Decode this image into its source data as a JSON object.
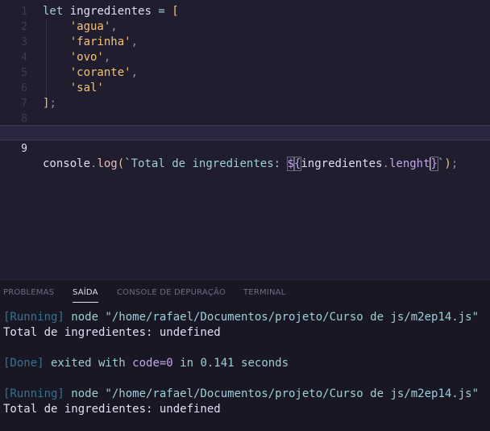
{
  "editor": {
    "lines": [
      {
        "num": "1",
        "tokens": [
          [
            "kw",
            "let"
          ],
          [
            "id",
            " ingredientes "
          ],
          [
            "op",
            "="
          ],
          [
            "id",
            " "
          ],
          [
            "br",
            "["
          ]
        ]
      },
      {
        "num": "2",
        "tokens": [
          [
            "id",
            "    "
          ],
          [
            "str",
            "'agua'"
          ],
          [
            "pn",
            ","
          ]
        ]
      },
      {
        "num": "3",
        "tokens": [
          [
            "id",
            "    "
          ],
          [
            "str",
            "'farinha'"
          ],
          [
            "pn",
            ","
          ]
        ]
      },
      {
        "num": "4",
        "tokens": [
          [
            "id",
            "    "
          ],
          [
            "str",
            "'ovo'"
          ],
          [
            "pn",
            ","
          ]
        ]
      },
      {
        "num": "5",
        "tokens": [
          [
            "id",
            "    "
          ],
          [
            "str",
            "'corante'"
          ],
          [
            "pn",
            ","
          ]
        ]
      },
      {
        "num": "6",
        "tokens": [
          [
            "id",
            "    "
          ],
          [
            "str",
            "'sal'"
          ]
        ]
      },
      {
        "num": "7",
        "tokens": [
          [
            "br",
            "]"
          ],
          [
            "pn",
            ";"
          ]
        ]
      },
      {
        "num": "8",
        "tokens": []
      },
      {
        "num": "9",
        "tokens": []
      }
    ],
    "line9": {
      "console": "console",
      "dot1": ".",
      "log": "log",
      "paren_open": "(",
      "backtick_open": "`",
      "text": "Total de ingredientes: ",
      "dollar": "$",
      "brace_open": "{",
      "object": "ingredientes",
      "dot2": ".",
      "property": "lenght",
      "brace_close": "}",
      "backtick_close": "`",
      "paren_close": ")",
      "semicolon": ";"
    }
  },
  "panel": {
    "tabs": [
      "PROBLEMAS",
      "SAÍDA",
      "CONSOLE DE DEPURAÇÃO",
      "TERMINAL"
    ],
    "active_tab": "SAÍDA",
    "output": {
      "run1_tag": "[Running]",
      "run1_cmd": " node \"/home/rafael/Documentos/projeto/Curso de js/m2ep14.js\"",
      "run1_result": "Total de ingredientes: undefined",
      "done_tag": "[Done]",
      "done_exited": " exited with ",
      "done_code": "code=0",
      "done_in": " in ",
      "done_time": "0.141",
      "done_seconds": " seconds",
      "run2_tag": "[Running]",
      "run2_cmd": " node \"/home/rafael/Documentos/projeto/Curso de js/m2ep14.js\"",
      "run2_result": "Total de ingredientes: undefined"
    }
  }
}
